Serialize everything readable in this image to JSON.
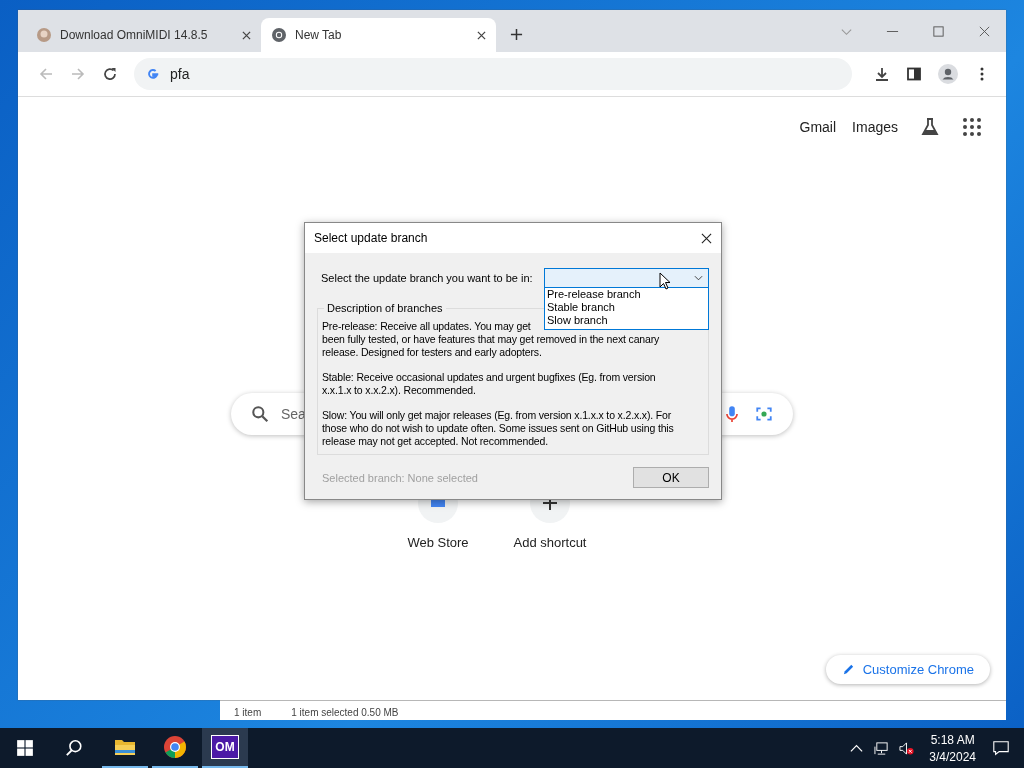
{
  "browser": {
    "tabs": [
      {
        "title": "Download OmniMIDI 14.8.5",
        "selected": false
      },
      {
        "title": "New Tab",
        "selected": true
      }
    ],
    "address": "pfa",
    "top_links": [
      "Gmail",
      "Images"
    ],
    "search": {
      "placeholder": "Sea"
    },
    "shortcuts": [
      "Web Store",
      "Add shortcut"
    ],
    "customize_button": "Customize Chrome"
  },
  "background_window": {
    "status_items": [
      "1 item",
      "1 item selected  0.50 MB"
    ]
  },
  "dialog": {
    "title": "Select update branch",
    "prompt": "Select the update branch you want to be in:",
    "dropdown": {
      "expanded": true,
      "options": [
        {
          "label": "Pre-release branch",
          "selected": false
        },
        {
          "label": "Stable branch",
          "selected": false
        },
        {
          "label": "Slow branch",
          "selected": false
        }
      ]
    },
    "group_title": "Description of branches",
    "descriptions": [
      {
        "lines": [
          "Pre-release: Receive all updates. You may get",
          "been fully tested, or have features that may get removed in the next canary",
          "release. Designed for testers and early adopters."
        ]
      },
      {
        "lines": [
          "Stable: Receive occasional updates and urgent bugfixes (Eg. from version",
          "x.x.1.x to x.x.2.x). Recommended."
        ]
      },
      {
        "lines": [
          "Slow: You will only get major releases (Eg. from version x.1.x.x to x.2.x.x). For",
          "those who do not wish to update often. Some issues sent on GitHub using this",
          "release may not get accepted. Not recommended."
        ]
      }
    ],
    "status": {
      "text": "Selected branch: None selected",
      "disabled": true
    },
    "ok_button": "OK"
  },
  "taskbar": {
    "apps": [
      {
        "kind": "explorer",
        "active": false
      },
      {
        "kind": "chrome",
        "active": false
      },
      {
        "kind": "omnimidi",
        "label": "OM",
        "active": true
      }
    ],
    "time": "5:18 AM",
    "date": "3/4/2024"
  }
}
